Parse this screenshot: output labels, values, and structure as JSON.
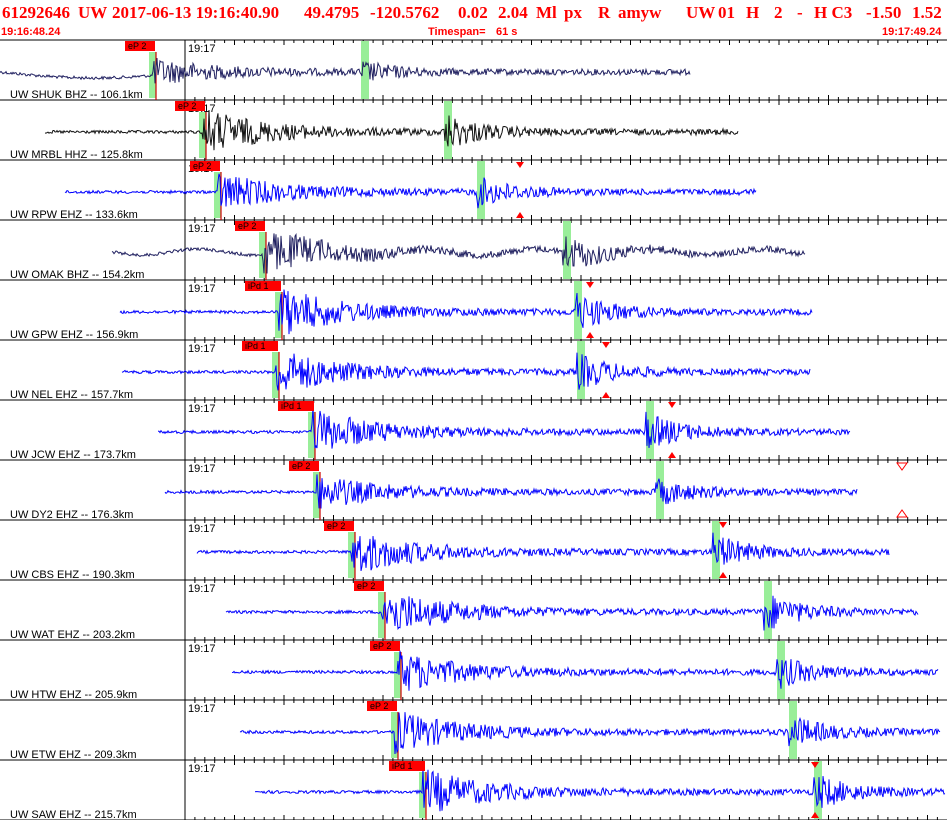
{
  "header": {
    "event_id": "61292646",
    "network": "UW",
    "datetime": "2017-06-13 19:16:40.90",
    "latitude": "49.4795",
    "longitude": "-120.5762",
    "depth": "0.02",
    "magnitude": "2.04",
    "mag_type": "Ml",
    "event_type": "px",
    "review_flag": "R",
    "author": "amyw",
    "net_code": "UW",
    "version": "01",
    "h_flag": "H",
    "count": "2",
    "dash": "-",
    "h_c3": "H C3",
    "val1": "-1.50",
    "val2": "1.52"
  },
  "time_bar": {
    "start_time": "19:16:48.24",
    "timespan_label": "Timespan=",
    "timespan_value": "61 s",
    "end_time": "19:17:49.24"
  },
  "colors": {
    "header": "#ff0000",
    "pick_box": "#ff0000",
    "s_marker": "#99ee99",
    "triangle": "#ff0000",
    "grid": "#000000"
  },
  "minute_mark": "19:17",
  "traces": [
    {
      "label": "UW SHUK BHZ -- 106.1km",
      "pick": "eP 2",
      "color": "#202060",
      "amp": 12,
      "drift": true
    },
    {
      "label": "UW MRBL HHZ -- 125.8km",
      "pick": "eP 2",
      "color": "#101010",
      "amp": 22
    },
    {
      "label": "UW RPW EHZ -- 133.6km",
      "pick": "eP 2",
      "color": "#0000ff",
      "amp": 18,
      "triangle": true
    },
    {
      "label": "UW OMAK BHZ -- 154.2km",
      "pick": "eP 2",
      "color": "#202060",
      "amp": 22
    },
    {
      "label": "UW GPW EHZ -- 156.9km",
      "pick": "iPd 1",
      "color": "#0000ff",
      "amp": 24,
      "triangle": true
    },
    {
      "label": "UW NEL EHZ -- 157.7km",
      "pick": "iPd 1",
      "color": "#0000ff",
      "amp": 22,
      "triangle": true
    },
    {
      "label": "UW JCW EHZ -- 173.7km",
      "pick": "iPd 1",
      "color": "#0000ff",
      "amp": 22,
      "triangle": true
    },
    {
      "label": "UW DY2 EHZ -- 176.3km",
      "pick": "eP 2",
      "color": "#0000ff",
      "amp": 16,
      "hollow": true
    },
    {
      "label": "UW CBS EHZ -- 190.3km",
      "pick": "eP 2",
      "color": "#0000ff",
      "amp": 22,
      "triangle": true
    },
    {
      "label": "UW WAT EHZ -- 203.2km",
      "pick": "eP 2",
      "color": "#0000ff",
      "amp": 24
    },
    {
      "label": "UW HTW EHZ -- 205.9km",
      "pick": "eP 2",
      "color": "#0000ff",
      "amp": 20
    },
    {
      "label": "UW ETW EHZ -- 209.3km",
      "pick": "eP 2",
      "color": "#0000ff",
      "amp": 20
    },
    {
      "label": "UW SAW EHZ -- 215.7km",
      "pick": "iPd 1",
      "color": "#0000ff",
      "amp": 22,
      "triangle": true
    }
  ]
}
